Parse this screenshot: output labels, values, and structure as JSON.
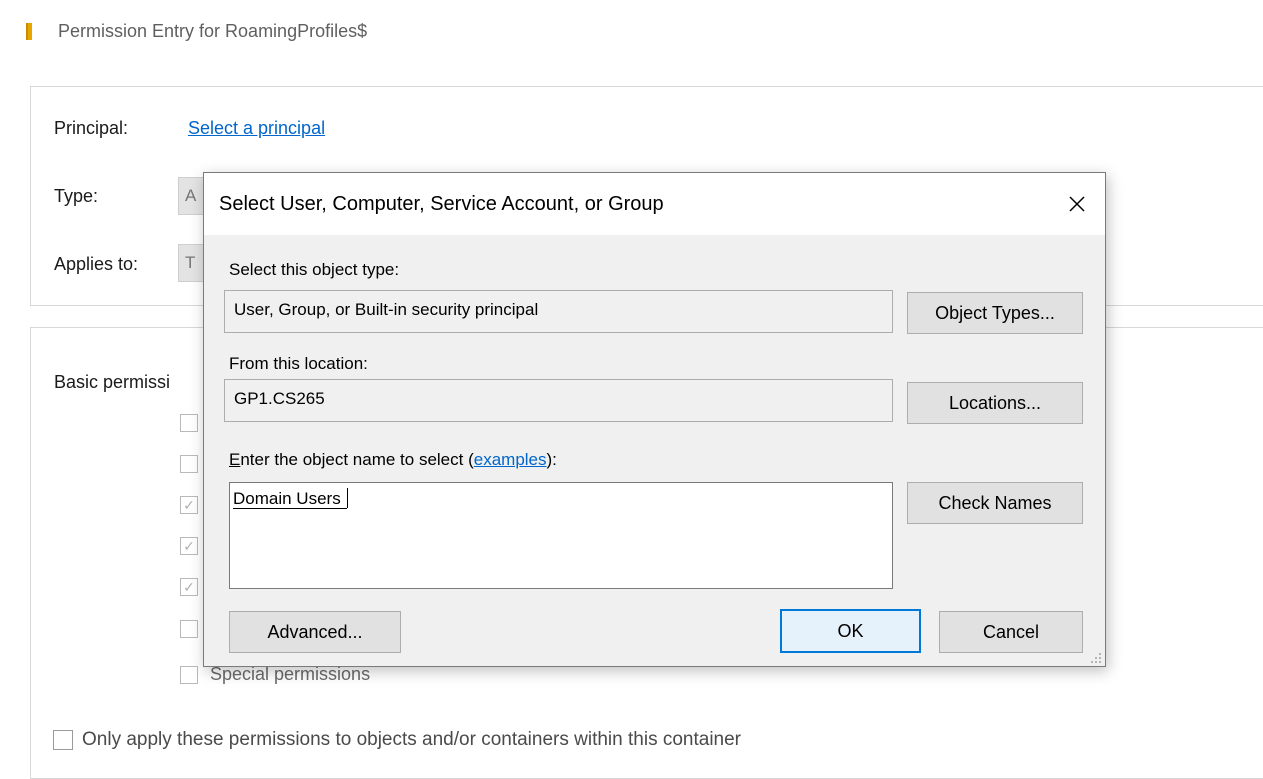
{
  "background_window": {
    "title": "Permission Entry for RoamingProfiles$",
    "principal_label": "Principal:",
    "principal_link": "Select a principal",
    "type_label": "Type:",
    "type_value_partial": "A",
    "applies_to_label": "Applies to:",
    "applies_to_value_partial": "T",
    "basic_permissions_partial": "Basic permissi",
    "special_permissions_label": "Special permissions",
    "only_apply_label": "Only apply these permissions to objects and/or containers within this container",
    "checkbox_states": [
      false,
      false,
      true,
      true,
      true,
      false,
      false
    ]
  },
  "dialog": {
    "title": "Select User, Computer, Service Account, or Group",
    "object_type_label": "Select this object type:",
    "object_type_value": "User, Group, or Built-in security principal",
    "object_types_button": "Object Types...",
    "location_label": "From this location:",
    "location_value": "GP1.CS265",
    "locations_button": "Locations...",
    "enter_name_prefix": "E",
    "enter_name_rest": "nter the object name to select (",
    "examples_link": "examples",
    "enter_name_suffix": "):",
    "object_name_value": "Domain Users",
    "check_names_button": "Check Names",
    "advanced_button": "Advanced...",
    "ok_button": "OK",
    "cancel_button": "Cancel"
  },
  "colors": {
    "link": "#0066cc",
    "default_button_border": "#0078d7",
    "dialog_background": "#f0f0f0"
  }
}
